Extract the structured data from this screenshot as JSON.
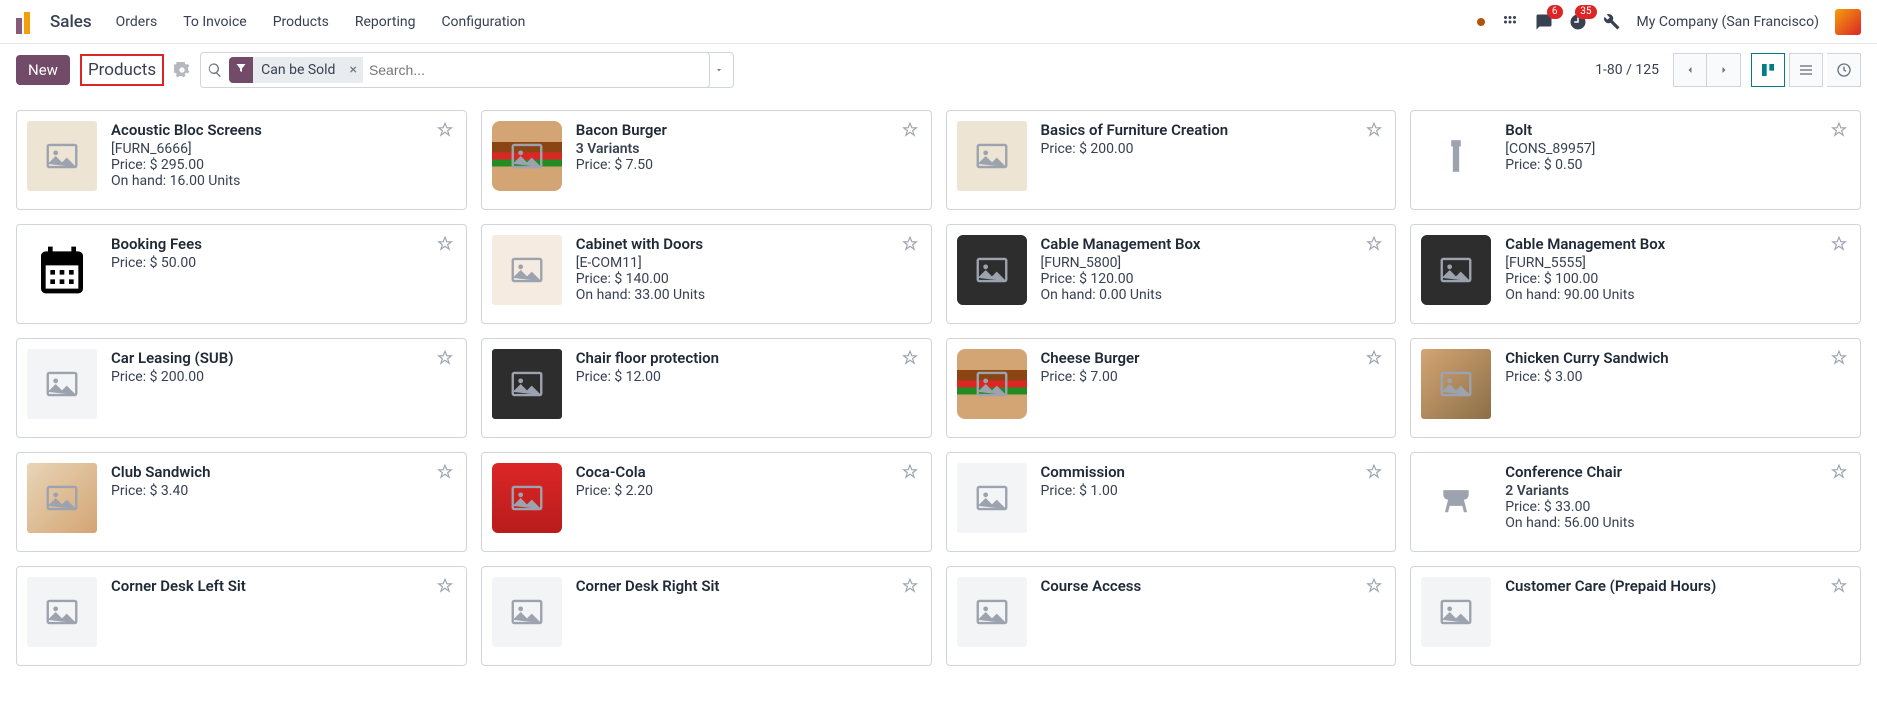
{
  "app": {
    "name": "Sales"
  },
  "menu": [
    "Orders",
    "To Invoice",
    "Products",
    "Reporting",
    "Configuration"
  ],
  "topright": {
    "msg_badge": "6",
    "clock_badge": "35",
    "company": "My Company (San Francisco)"
  },
  "toolbar": {
    "new_label": "New",
    "breadcrumb": "Products"
  },
  "search": {
    "filter_label": "Can be Sold",
    "placeholder": "Search..."
  },
  "pager": {
    "text": "1-80 / 125"
  },
  "labels": {
    "price": "Price:",
    "onhand": "On hand:",
    "variants": "Variants"
  },
  "products": [
    {
      "name": "Acoustic Bloc Screens",
      "sub": "[FURN_6666]",
      "price": "$ 295.00",
      "onhand": "16.00 Units",
      "thumb": "furniture"
    },
    {
      "name": "Bacon Burger",
      "variants": "3 Variants",
      "price": "$ 7.50",
      "thumb": "burger"
    },
    {
      "name": "Basics of Furniture Creation",
      "price": "$ 200.00",
      "thumb": "furniture"
    },
    {
      "name": "Bolt",
      "sub": "[CONS_89957]",
      "price": "$ 0.50",
      "thumb": "bolt"
    },
    {
      "name": "Booking Fees",
      "price": "$ 50.00",
      "thumb": "cal"
    },
    {
      "name": "Cabinet with Doors",
      "sub": "[E-COM11]",
      "price": "$ 140.00",
      "onhand": "33.00 Units",
      "thumb": "cabinet"
    },
    {
      "name": "Cable Management Box",
      "sub": "[FURN_5800]",
      "price": "$ 120.00",
      "onhand": "0.00 Units",
      "thumb": "box"
    },
    {
      "name": "Cable Management Box",
      "sub": "[FURN_5555]",
      "price": "$ 100.00",
      "onhand": "90.00 Units",
      "thumb": "box"
    },
    {
      "name": "Car Leasing (SUB)",
      "price": "$ 200.00",
      "thumb": "img"
    },
    {
      "name": "Chair floor protection",
      "price": "$ 12.00",
      "thumb": "chair"
    },
    {
      "name": "Cheese Burger",
      "price": "$ 7.00",
      "thumb": "burger"
    },
    {
      "name": "Chicken Curry Sandwich",
      "price": "$ 3.00",
      "thumb": "chick"
    },
    {
      "name": "Club Sandwich",
      "price": "$ 3.40",
      "thumb": "sand"
    },
    {
      "name": "Coca-Cola",
      "price": "$ 2.20",
      "thumb": "coke"
    },
    {
      "name": "Commission",
      "price": "$ 1.00",
      "thumb": "img"
    },
    {
      "name": "Conference Chair",
      "variants": "2 Variants",
      "price": "$ 33.00",
      "onhand": "56.00 Units",
      "thumb": "conf"
    },
    {
      "name": "Corner Desk Left Sit",
      "thumb": "img"
    },
    {
      "name": "Corner Desk Right Sit",
      "thumb": "img"
    },
    {
      "name": "Course Access",
      "thumb": "img"
    },
    {
      "name": "Customer Care (Prepaid Hours)",
      "thumb": "img"
    }
  ]
}
